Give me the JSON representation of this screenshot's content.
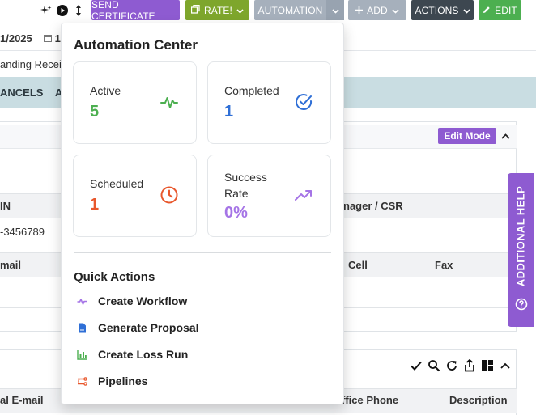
{
  "toolbar": {
    "send_certificate": "SEND CERTIFICATE",
    "rate": "RATE!",
    "automation": "AUTOMATION",
    "add": "ADD",
    "actions": "ACTIONS",
    "edit": "EDIT"
  },
  "background": {
    "date_partial": "1/2025",
    "date_partial2": "1",
    "outstanding_partial": "anding Receiv",
    "tab_cancels": "ANCELS",
    "tab_a": "A",
    "edit_mode": "Edit Mode",
    "col_in": "IN",
    "col_manager": "nager / CSR",
    "phone_partial": "-3456789",
    "col_email": "mail",
    "col_cell": "Cell",
    "col_fax": "Fax",
    "col_email2": "al E-mail",
    "col_office_phone": "ffice Phone",
    "col_description": "Description"
  },
  "help": {
    "label": "ADDITIONAL HELP"
  },
  "panel": {
    "title": "Automation Center",
    "stats": {
      "active": {
        "label": "Active",
        "value": "5",
        "color": "#4caf50"
      },
      "completed": {
        "label": "Completed",
        "value": "1",
        "color": "#2f6fd6"
      },
      "scheduled": {
        "label": "Scheduled",
        "value": "1",
        "color": "#e8572c"
      },
      "success": {
        "label_line1": "Success",
        "label_line2": "Rate",
        "value": "0%",
        "color": "#a574e6"
      }
    },
    "quick_actions_title": "Quick Actions",
    "quick_actions": [
      {
        "label": "Create Workflow",
        "icon": "workflow-icon"
      },
      {
        "label": "Generate Proposal",
        "icon": "document-icon"
      },
      {
        "label": "Create Loss Run",
        "icon": "bar-chart-icon"
      },
      {
        "label": "Pipelines",
        "icon": "pipeline-icon"
      }
    ]
  }
}
